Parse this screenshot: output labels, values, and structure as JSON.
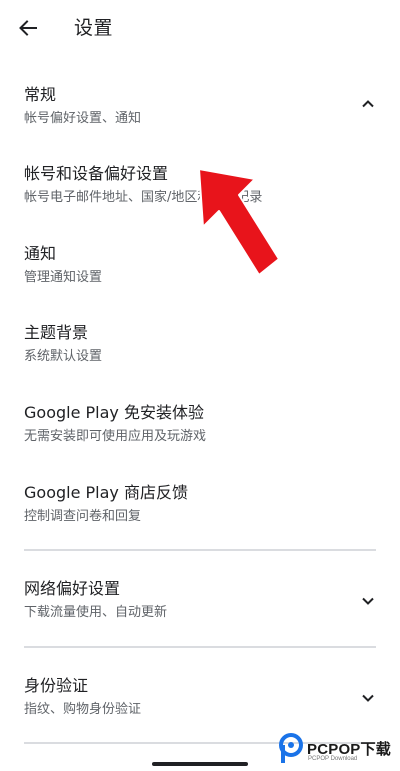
{
  "header": {
    "title": "设置",
    "back_icon": "arrow-left-icon"
  },
  "settings": {
    "general": {
      "title": "常规",
      "subtitle": "帐号偏好设置、通知",
      "expanded": true,
      "chevron_icon": "chevron-up-icon"
    },
    "general_items": [
      {
        "title": "帐号和设备偏好设置",
        "subtitle": "帐号电子邮件地址、国家/地区和历史记录"
      },
      {
        "title": "通知",
        "subtitle": "管理通知设置"
      },
      {
        "title": "主题背景",
        "subtitle": "系统默认设置"
      },
      {
        "title": "Google Play 免安装体验",
        "subtitle": "无需安装即可使用应用及玩游戏"
      },
      {
        "title": "Google Play 商店反馈",
        "subtitle": "控制调查问卷和回复"
      }
    ],
    "network": {
      "title": "网络偏好设置",
      "subtitle": "下载流量使用、自动更新",
      "expanded": false,
      "chevron_icon": "chevron-down-icon"
    },
    "auth": {
      "title": "身份验证",
      "subtitle": "指纹、购物身份验证",
      "expanded": false,
      "chevron_icon": "chevron-down-icon"
    }
  },
  "annotation": {
    "arrow_color": "#e8141b",
    "icon": "red-pointer-arrow"
  },
  "watermark": {
    "brand": "PCPOP下载",
    "sub": "PCPOP Download",
    "logo_color": "#1a73e8"
  }
}
